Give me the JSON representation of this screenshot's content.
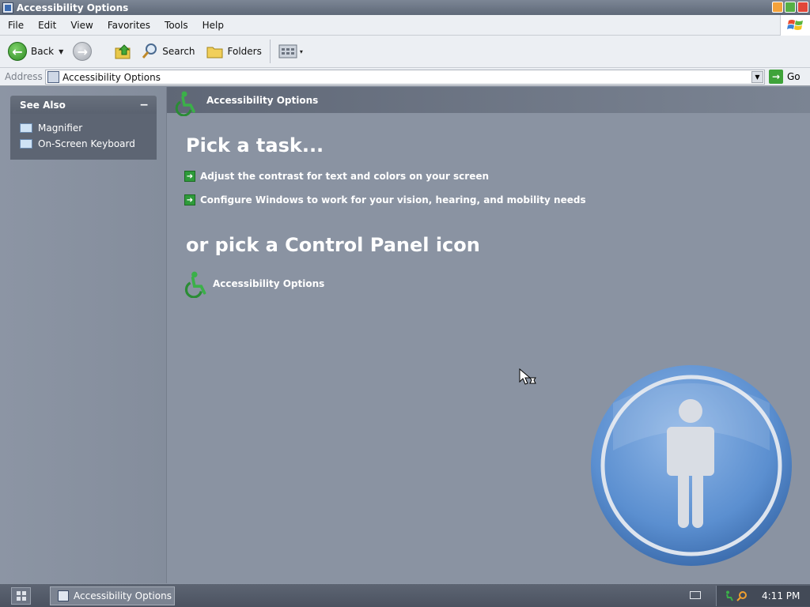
{
  "window": {
    "title": "Accessibility Options"
  },
  "menu": [
    "File",
    "Edit",
    "View",
    "Favorites",
    "Tools",
    "Help"
  ],
  "toolbar": {
    "back_label": "Back",
    "search_label": "Search",
    "folders_label": "Folders"
  },
  "address": {
    "label": "Address",
    "value": "Accessibility Options",
    "go_label": "Go"
  },
  "sidebar": {
    "see_also_title": "See Also",
    "collapse_glyph": "−",
    "items": [
      {
        "label": "Magnifier",
        "icon": "magnifier-icon"
      },
      {
        "label": "On-Screen Keyboard",
        "icon": "keyboard-icon"
      }
    ]
  },
  "main": {
    "banner_title": "Accessibility Options",
    "pick_task_heading": "Pick a task...",
    "tasks": [
      "Adjust the contrast for text and colors on your screen",
      "Configure Windows to work for your vision, hearing, and mobility needs"
    ],
    "pick_icon_heading": "or pick a Control Panel icon",
    "cp_icons": [
      {
        "label": "Accessibility Options",
        "icon": "wheelchair-icon"
      }
    ]
  },
  "taskbar": {
    "active_window": "Accessibility Options",
    "clock": "4:11 PM"
  },
  "colors": {
    "accent_green": "#2e9b3a",
    "badge_blue": "#5b8fd0",
    "pane_bg": "#8a93a2"
  }
}
